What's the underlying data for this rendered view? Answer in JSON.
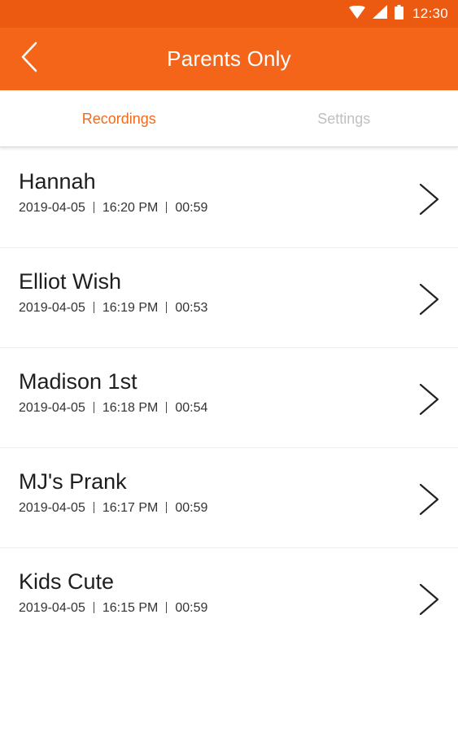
{
  "status_bar": {
    "time": "12:30",
    "icons": [
      "wifi-icon",
      "signal-icon",
      "battery-icon"
    ]
  },
  "header": {
    "title": "Parents Only",
    "back_icon": "chevron-left-icon"
  },
  "tabs": [
    {
      "label": "Recordings",
      "active": true
    },
    {
      "label": "Settings",
      "active": false
    }
  ],
  "recordings": [
    {
      "name": "Hannah",
      "date": "2019-04-05",
      "time": "16:20 PM",
      "duration": "00:59"
    },
    {
      "name": "Elliot Wish",
      "date": "2019-04-05",
      "time": "16:19 PM",
      "duration": "00:53"
    },
    {
      "name": "Madison 1st",
      "date": "2019-04-05",
      "time": "16:18 PM",
      "duration": "00:54"
    },
    {
      "name": "MJ's Prank",
      "date": "2019-04-05",
      "time": "16:17 PM",
      "duration": "00:59"
    },
    {
      "name": "Kids Cute",
      "date": "2019-04-05",
      "time": "16:15 PM",
      "duration": "00:59"
    }
  ],
  "colors": {
    "status_bar": "#ec5a12",
    "app_bar": "#f4651a",
    "accent": "#f26a1b",
    "inactive_tab": "#bfbfbf"
  }
}
